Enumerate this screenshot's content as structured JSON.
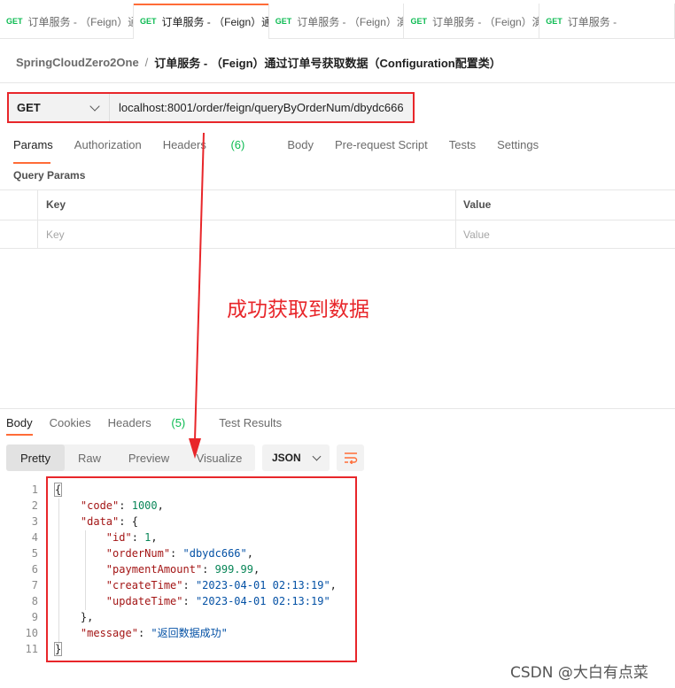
{
  "tabs": [
    {
      "method": "GET",
      "title": "订单服务 - （Feign）通过"
    },
    {
      "method": "GET",
      "title": "订单服务 - （Feign）通过"
    },
    {
      "method": "GET",
      "title": "订单服务 - （Feign）演示"
    },
    {
      "method": "GET",
      "title": "订单服务 - （Feign）演示"
    },
    {
      "method": "GET",
      "title": "订单服务 -"
    }
  ],
  "breadcrumb": {
    "collection": "SpringCloudZero2One",
    "separator": "/",
    "request": "订单服务 - （Feign）通过订单号获取数据（Configuration配置类）"
  },
  "request": {
    "method": "GET",
    "url": "localhost:8001/order/feign/queryByOrderNum/dbydc666"
  },
  "request_tabs": {
    "params": "Params",
    "authorization": "Authorization",
    "headers": "Headers",
    "headers_count": "(6)",
    "body": "Body",
    "prerequest": "Pre-request Script",
    "tests": "Tests",
    "settings": "Settings"
  },
  "query_params": {
    "title": "Query Params",
    "col_key": "Key",
    "col_value": "Value",
    "ph_key": "Key",
    "ph_value": "Value"
  },
  "annotation": "成功获取到数据",
  "response_tabs": {
    "body": "Body",
    "cookies": "Cookies",
    "headers": "Headers",
    "headers_count": "(5)",
    "tests": "Test Results"
  },
  "view_modes": {
    "pretty": "Pretty",
    "raw": "Raw",
    "preview": "Preview",
    "visualize": "Visualize"
  },
  "format": "JSON",
  "line_numbers": [
    "1",
    "2",
    "3",
    "4",
    "5",
    "6",
    "7",
    "8",
    "9",
    "10",
    "11"
  ],
  "response_json": {
    "open": "{",
    "code_key": "\"code\"",
    "code_val": "1000",
    "data_key": "\"data\"",
    "data_open": "{",
    "id_key": "\"id\"",
    "id_val": "1",
    "ordernum_key": "\"orderNum\"",
    "ordernum_val": "\"dbydc666\"",
    "amount_key": "\"paymentAmount\"",
    "amount_val": "999.99",
    "create_key": "\"createTime\"",
    "create_val": "\"2023-04-01 02:13:19\"",
    "update_key": "\"updateTime\"",
    "update_val": "\"2023-04-01 02:13:19\"",
    "data_close": "},",
    "message_key": "\"message\"",
    "message_val": "\"返回数据成功\"",
    "close": "}"
  },
  "watermark": "CSDN @大白有点菜",
  "colors": {
    "accent": "#ff6c37",
    "get_method": "#0cbb52",
    "annotation_red": "#e8262a"
  }
}
